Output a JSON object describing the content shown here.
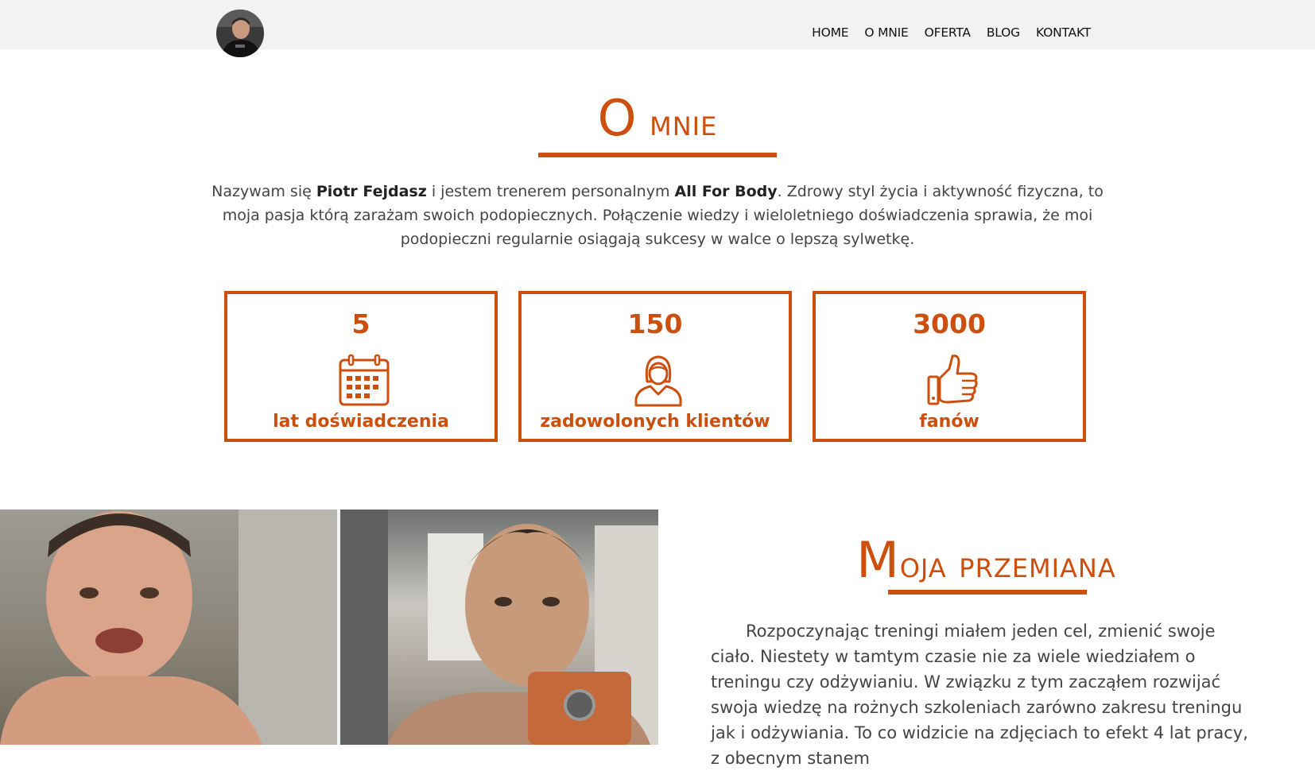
{
  "nav": {
    "items": [
      "HOME",
      "O MNIE",
      "OFERTA",
      "BLOG",
      "KONTAKT"
    ]
  },
  "about": {
    "title_initial": "O",
    "title_rest": " mnie",
    "intro": {
      "p1": "Nazywam się ",
      "name": "Piotr Fejdasz",
      "p2": " i jestem trenerem personalnym ",
      "brand": "All For Body",
      "p3": ". Zdrowy styl życia i aktywność fizyczna, to moja pasja którą zarażam swoich podopiecznych. Połączenie wiedzy i wieloletniego doświadczenia sprawia, że moi podopieczni regularnie osiągają sukcesy w walce o lepszą sylwetkę."
    },
    "stats": [
      {
        "value": "5",
        "label": "lat doświadczenia",
        "icon": "calendar-icon"
      },
      {
        "value": "150",
        "label": "zadowolonych klientów",
        "icon": "person-icon"
      },
      {
        "value": "3000",
        "label": "fanów",
        "icon": "thumbs-up-icon"
      }
    ]
  },
  "transformation": {
    "title_initial": "M",
    "title_rest": "oja przemiana",
    "text": "Rozpoczynając treningi miałem jeden cel, zmienić swoje ciało. Niestety w tamtym czasie nie za wiele wiedziałem o treningu czy odżywianiu. W związku z tym zacząłem rozwijać swoja wiedzę na rożnych szkoleniach zarówno zakresu treningu jak i odżywiania. To co widzicie na zdjęciach to efekt 4 lat pracy, z obecnym stanem"
  },
  "colors": {
    "accent": "#cc4f0d",
    "navbar_bg": "#f2f2f2"
  }
}
